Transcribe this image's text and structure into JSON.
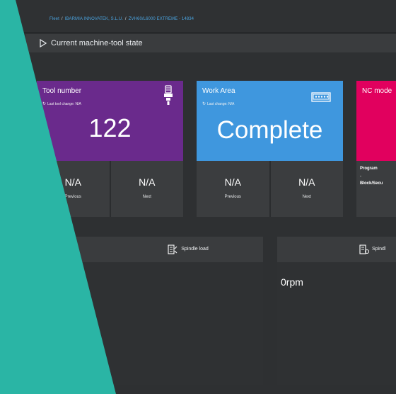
{
  "breadcrumb": {
    "items": [
      "Fleet",
      "IBARMIA INNOVATEK, S.L.U.",
      "ZVH60/L6000 EXTREME - 14834"
    ]
  },
  "section": {
    "title": "Current machine-tool state"
  },
  "cards": {
    "tool": {
      "title": "Tool number",
      "subtitle": "Last tool change: N/A",
      "value": "122",
      "color": "#6a2a8c",
      "previous_value": "N/A",
      "previous_label": "Previous",
      "next_value": "N/A",
      "next_label": "Next"
    },
    "work_area": {
      "title": "Work Area",
      "subtitle": "Last change: N/A",
      "value": "Complete",
      "color": "#3f97de",
      "previous_value": "N/A",
      "previous_label": "Previous",
      "next_value": "N/A",
      "next_label": "Next"
    },
    "nc_mode": {
      "title": "NC mode",
      "color": "#e1005e",
      "program_label": "Program",
      "program_value": "-",
      "block_label": "Block/Secu"
    }
  },
  "panels": {
    "spindle_load": {
      "title": "Spindle load"
    },
    "spindle_speed": {
      "title": "Spindl",
      "value": "0rpm"
    }
  },
  "colors": {
    "accent_teal": "#2ab5a5"
  }
}
